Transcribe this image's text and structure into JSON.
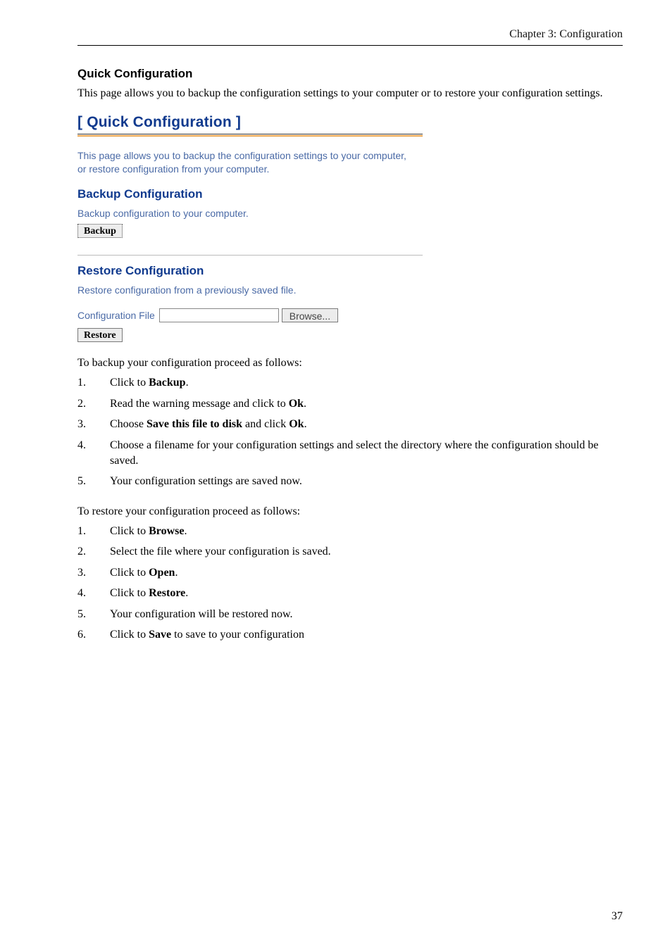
{
  "header": {
    "chapter": "Chapter 3: Configuration"
  },
  "doc": {
    "title": "Quick Configuration",
    "intro": "This page allows you to backup the configuration settings to your computer or to restore your configuration settings."
  },
  "ui": {
    "title": "[ Quick Configuration ]",
    "intro_line1": "This page allows you to backup the configuration settings to your computer,",
    "intro_line2": "or restore configuration from your computer.",
    "backup_heading": "Backup Configuration",
    "backup_text": "Backup configuration to your computer.",
    "backup_button": "Backup",
    "restore_heading": "Restore Configuration",
    "restore_text": "Restore configuration from a previously saved file.",
    "file_label": "Configuration File",
    "file_value": "",
    "browse_button": "Browse...",
    "restore_button": "Restore"
  },
  "backup_steps_intro": "To backup your configuration proceed as follows:",
  "backup_steps": [
    {
      "n": "1.",
      "pre": "Click to ",
      "b": "Backup",
      "post": "."
    },
    {
      "n": "2.",
      "pre": "Read the warning message and click to ",
      "b": "Ok",
      "post": "."
    },
    {
      "n": "3.",
      "pre": "Choose ",
      "b": "Save this file to disk",
      "post": " and click ",
      "b2": "Ok",
      "post2": "."
    },
    {
      "n": "4.",
      "pre": "Choose a filename for your configuration settings and select the directory where the configuration should be saved.",
      "b": "",
      "post": ""
    },
    {
      "n": "5.",
      "pre": "Your configuration settings are saved now.",
      "b": "",
      "post": ""
    }
  ],
  "restore_steps_intro": "To restore your configuration proceed as follows:",
  "restore_steps": [
    {
      "n": "1.",
      "pre": "Click to ",
      "b": "Browse",
      "post": "."
    },
    {
      "n": "2.",
      "pre": "Select the file where your configuration is saved.",
      "b": "",
      "post": ""
    },
    {
      "n": "3.",
      "pre": "Click to ",
      "b": "Open",
      "post": "."
    },
    {
      "n": "4.",
      "pre": "Click to ",
      "b": "Restore",
      "post": "."
    },
    {
      "n": "5.",
      "pre": "Your configuration will be restored now.",
      "b": "",
      "post": ""
    },
    {
      "n": "6.",
      "pre": "Click to ",
      "b": "Save",
      "post": " to save to your configuration"
    }
  ],
  "page_number": "37"
}
